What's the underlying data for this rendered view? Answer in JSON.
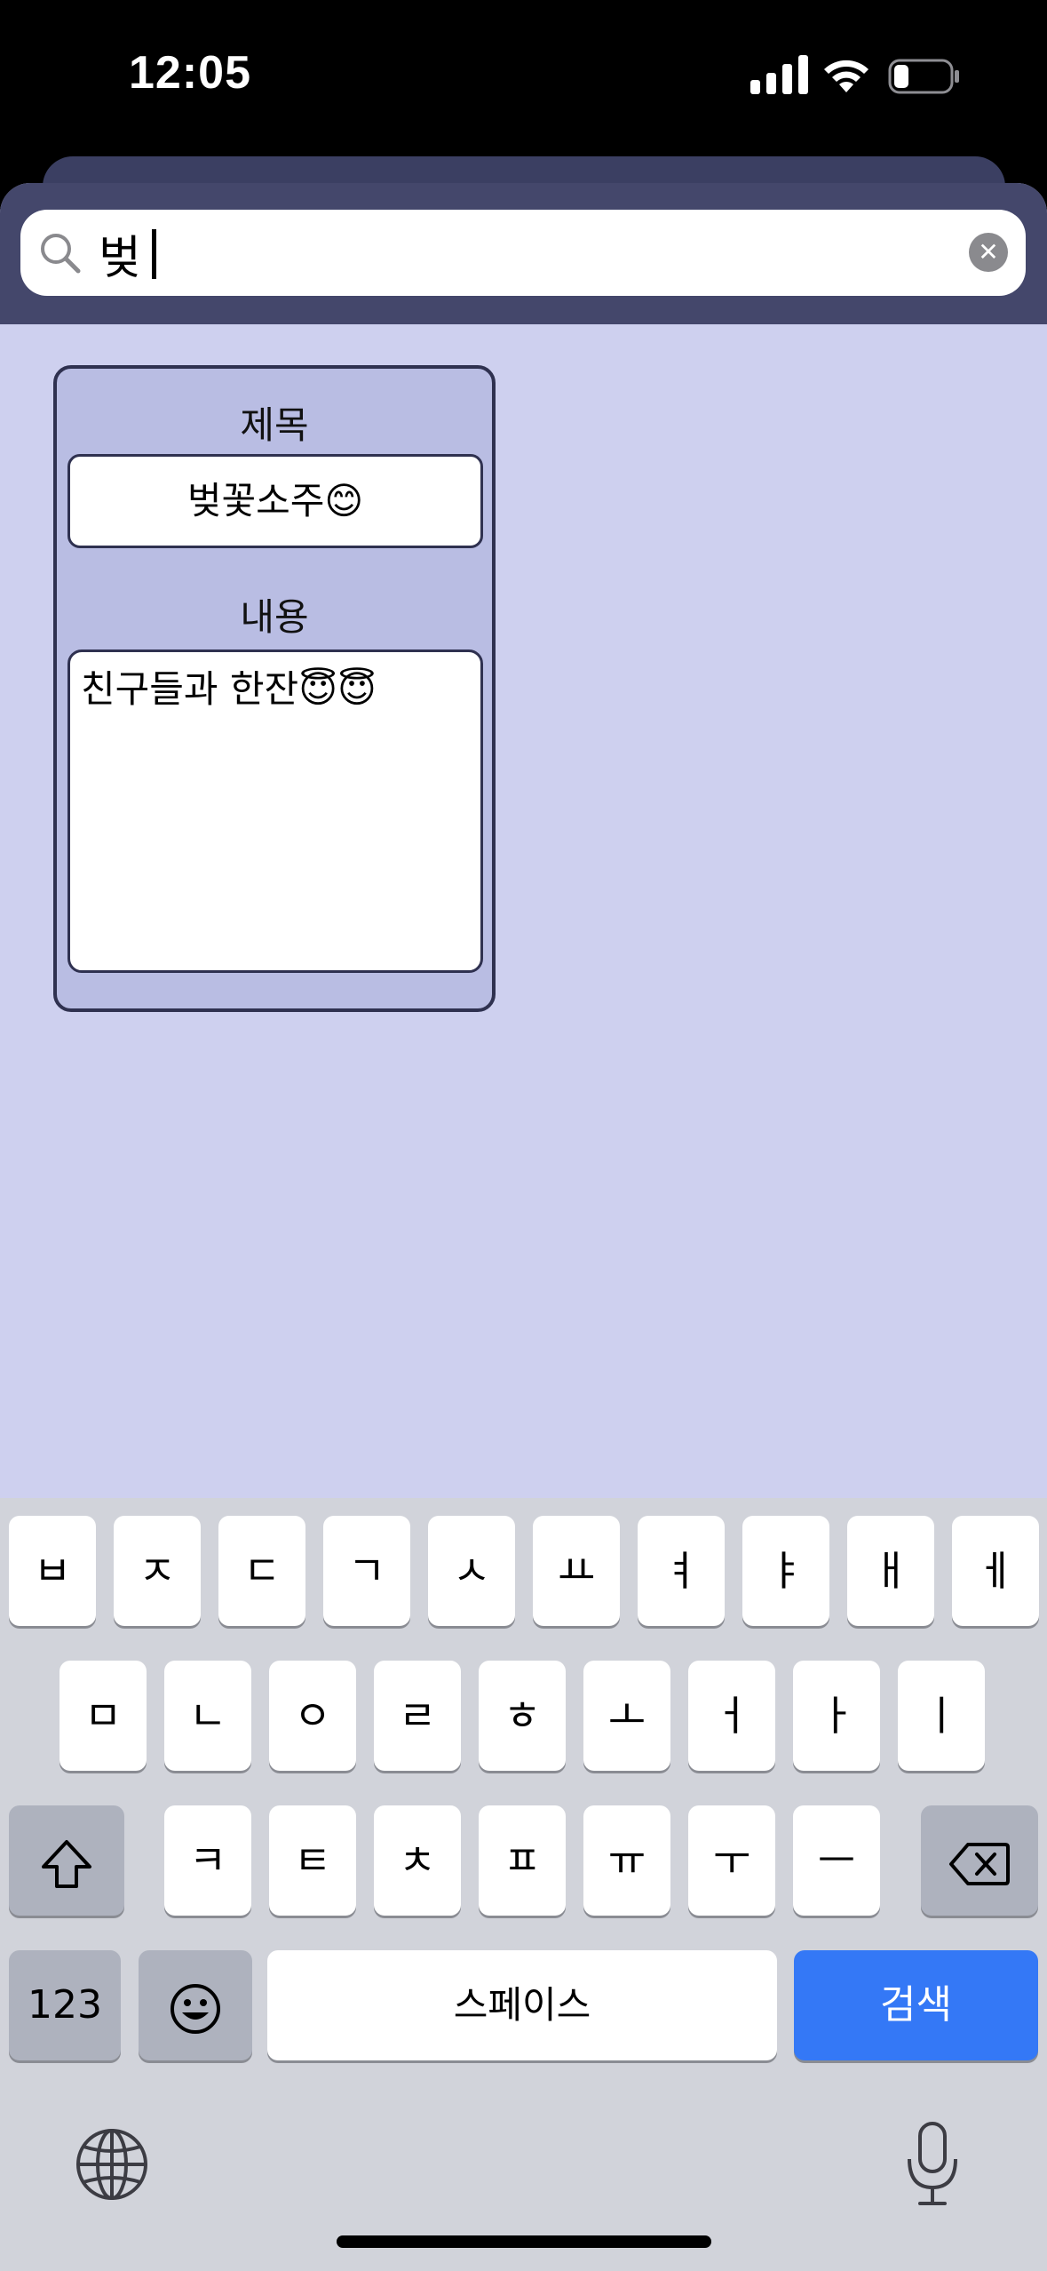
{
  "status_bar": {
    "time": "12:05"
  },
  "search": {
    "value": "벚",
    "clear_icon": "clear-circle-icon"
  },
  "memo": {
    "title_label": "제목",
    "title_value": "벚꽃소주😊",
    "content_label": "내용",
    "content_value": "친구들과 한잔😇😇"
  },
  "keyboard": {
    "row1": [
      "ㅂ",
      "ㅈ",
      "ㄷ",
      "ㄱ",
      "ㅅ",
      "ㅛ",
      "ㅕ",
      "ㅑ",
      "ㅐ",
      "ㅔ"
    ],
    "row2": [
      "ㅁ",
      "ㄴ",
      "ㅇ",
      "ㄹ",
      "ㅎ",
      "ㅗ",
      "ㅓ",
      "ㅏ",
      "ㅣ"
    ],
    "row3": [
      "ㅋ",
      "ㅌ",
      "ㅊ",
      "ㅍ",
      "ㅠ",
      "ㅜ",
      "ㅡ"
    ],
    "numbers_label": "123",
    "space_label": "스페이스",
    "search_label": "검색"
  },
  "colors": {
    "sheet_bg": "#ced0ef",
    "header_band": "#44476b",
    "card_bg": "#b9bde3",
    "accent": "#3478f6"
  }
}
